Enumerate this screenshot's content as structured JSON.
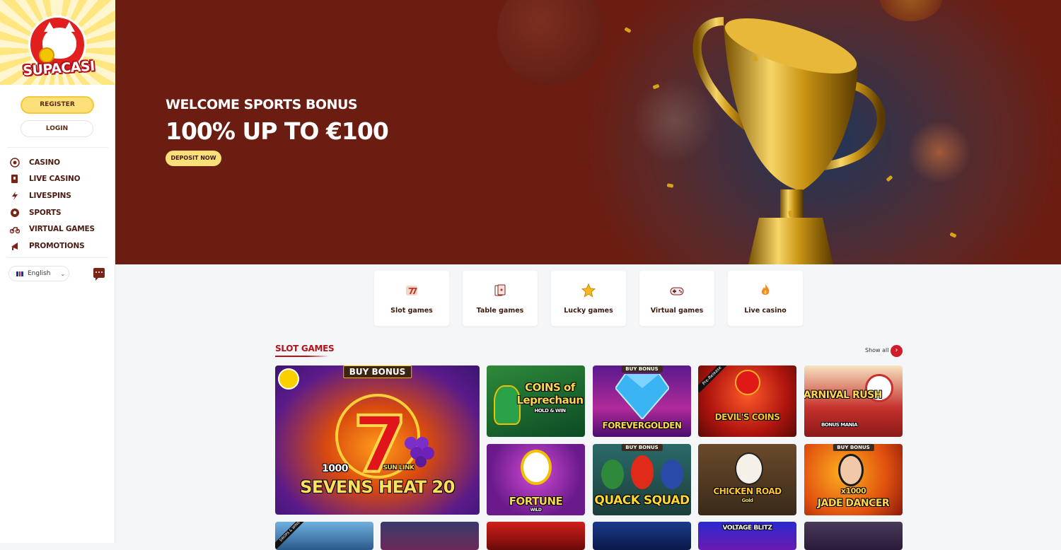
{
  "sidebar": {
    "logo_text": "SUPACASI",
    "register_label": "REGISTER",
    "login_label": "LOGIN",
    "nav": [
      {
        "label": "CASINO",
        "icon": "roulette-icon"
      },
      {
        "label": "LIVE CASINO",
        "icon": "cards-icon"
      },
      {
        "label": "LIVESPINS",
        "icon": "bolt-icon"
      },
      {
        "label": "SPORTS",
        "icon": "soccer-ball-icon"
      },
      {
        "label": "VIRTUAL GAMES",
        "icon": "motorbike-icon"
      },
      {
        "label": "PROMOTIONS",
        "icon": "megaphone-icon"
      }
    ],
    "language": "English"
  },
  "banner": {
    "subtitle": "WELCOME SPORTS BONUS",
    "title": "100% UP TO €100",
    "cta": "DEPOSIT NOW"
  },
  "categories": [
    {
      "label": "Slot games",
      "icon": "slot-seven-icon"
    },
    {
      "label": "Table games",
      "icon": "playing-cards-icon"
    },
    {
      "label": "Lucky games",
      "icon": "star-icon"
    },
    {
      "label": "Virtual games",
      "icon": "gamepad-icon"
    },
    {
      "label": "Live casino",
      "icon": "flame-icon"
    }
  ],
  "slot_section": {
    "title": "SLOT GAMES",
    "show_all": "Show all",
    "featured": {
      "badge": "BUY BONUS",
      "line1": "1000",
      "line2": "SEVENS HEAT 20",
      "sub": "SUN LINK"
    },
    "games": [
      {
        "name": "COINS of Leprechaun",
        "sub": "HOLD & WIN",
        "badge": ""
      },
      {
        "name": "FOREVERGOLDEN",
        "sub": "",
        "badge": "BUY BONUS"
      },
      {
        "name": "DEVIL'S COINS",
        "sub": "",
        "badge": "",
        "corner": "Pre-Release"
      },
      {
        "name": "CARNIVAL RUSH",
        "sub": "BONUS MANIA",
        "badge": ""
      },
      {
        "name": "FORTUNE",
        "sub": "WILD",
        "badge": ""
      },
      {
        "name": "QUACK SQUAD",
        "sub": "",
        "badge": "BUY BONUS"
      },
      {
        "name": "CHICKEN ROAD",
        "sub": "Gold",
        "badge": ""
      },
      {
        "name": "JADE DANCER",
        "sub": "x1000",
        "badge": "BUY BONUS"
      }
    ],
    "row3_partial": [
      {
        "name": "",
        "corner": "DROPS & WINS"
      },
      {
        "name": ""
      },
      {
        "name": ""
      },
      {
        "name": ""
      },
      {
        "name": "VOLTAGE BLITZ"
      },
      {
        "name": ""
      }
    ]
  },
  "colors": {
    "brand_red": "#b3121b",
    "banner_bg": "#6b1d12",
    "accent_yellow": "#fbe07a"
  }
}
